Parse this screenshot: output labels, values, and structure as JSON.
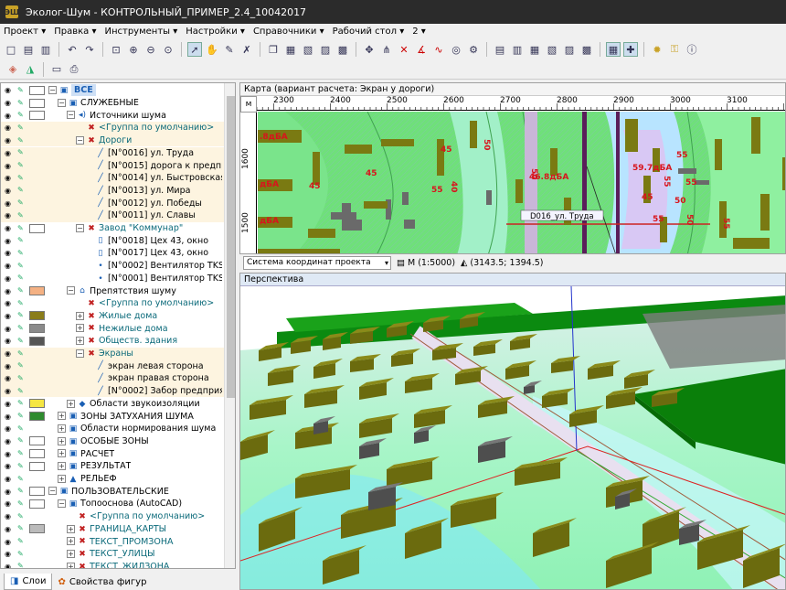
{
  "window": {
    "title": "Эколог-Шум - КОНТРОЛЬНЫЙ_ПРИМЕР_2.4_10042017",
    "logo": "ЭШ"
  },
  "menu": [
    {
      "label": "Проект"
    },
    {
      "label": "Правка"
    },
    {
      "label": "Инструменты"
    },
    {
      "label": "Настройки"
    },
    {
      "label": "Справочники"
    },
    {
      "label": "Рабочий стол"
    },
    {
      "label": "2"
    }
  ],
  "layers": [
    {
      "label": "ВСЕ",
      "indent": 0,
      "swatch": "#ffffff",
      "expand": "−",
      "icon": "folder-icon",
      "glyph": "▣",
      "color": "#1a5fb4",
      "bold": true,
      "style": "sel"
    },
    {
      "label": "СЛУЖЕБНЫЕ",
      "indent": 1,
      "swatch": "#ffffff",
      "expand": "−",
      "icon": "folder-icon",
      "glyph": "▣",
      "color": "#000"
    },
    {
      "label": "Источники шума",
      "indent": 2,
      "swatch": "#ffffff",
      "expand": "−",
      "icon": "noise-source-icon",
      "glyph": "◂)",
      "color": "#000"
    },
    {
      "label": "<Группа по умолчанию>",
      "indent": 3,
      "swatch": "",
      "expand": "",
      "icon": "group-icon",
      "glyph": "✖",
      "color": "#0b6a7a",
      "style": "hl"
    },
    {
      "label": "Дороги",
      "indent": 3,
      "swatch": "",
      "expand": "−",
      "icon": "road-group-icon",
      "glyph": "✖",
      "color": "#0b6a7a",
      "style": "hl"
    },
    {
      "label": "[N°0016] ул. Труда",
      "indent": 4,
      "swatch": "",
      "expand": "",
      "icon": "road-icon",
      "glyph": "╱",
      "color": "#000",
      "style": "hl"
    },
    {
      "label": "[N°0015] дорога к предпр...",
      "indent": 4,
      "swatch": "",
      "expand": "",
      "icon": "road-icon",
      "glyph": "╱",
      "color": "#000",
      "style": "hl"
    },
    {
      "label": "[N°0014] ул. Быстровская",
      "indent": 4,
      "swatch": "",
      "expand": "",
      "icon": "road-icon",
      "glyph": "╱",
      "color": "#000",
      "style": "hl"
    },
    {
      "label": "[N°0013] ул. Мира",
      "indent": 4,
      "swatch": "",
      "expand": "",
      "icon": "road-icon",
      "glyph": "╱",
      "color": "#000",
      "style": "hl"
    },
    {
      "label": "[N°0012] ул. Победы",
      "indent": 4,
      "swatch": "",
      "expand": "",
      "icon": "road-icon",
      "glyph": "╱",
      "color": "#000",
      "style": "hl"
    },
    {
      "label": "[N°0011] ул. Славы",
      "indent": 4,
      "swatch": "",
      "expand": "",
      "icon": "road-icon",
      "glyph": "╱",
      "color": "#000",
      "style": "hl"
    },
    {
      "label": "Завод \"Коммунар\"",
      "indent": 3,
      "swatch": "#ffffff",
      "expand": "−",
      "icon": "factory-group-icon",
      "glyph": "✖",
      "color": "#0b6a7a"
    },
    {
      "label": "[N°0018] Цех 43, окно",
      "indent": 4,
      "swatch": "",
      "expand": "",
      "icon": "window-source-icon",
      "glyph": "▯",
      "color": "#000"
    },
    {
      "label": "[N°0017] Цех 43, окно",
      "indent": 4,
      "swatch": "",
      "expand": "",
      "icon": "window-source-icon",
      "glyph": "▯",
      "color": "#000"
    },
    {
      "label": "[N°0002] Вентилятор TKS 4...",
      "indent": 4,
      "swatch": "",
      "expand": "",
      "icon": "point-source-icon",
      "glyph": "•",
      "color": "#000"
    },
    {
      "label": "[N°0001] Вентилятор TKS 4...",
      "indent": 4,
      "swatch": "",
      "expand": "",
      "icon": "point-source-icon",
      "glyph": "•",
      "color": "#000"
    },
    {
      "label": "Препятствия шуму",
      "indent": 2,
      "swatch": "#f4b183",
      "expand": "−",
      "icon": "obstacle-icon",
      "glyph": "⌂",
      "color": "#000"
    },
    {
      "label": "<Группа по умолчанию>",
      "indent": 3,
      "swatch": "",
      "expand": "",
      "icon": "group-icon",
      "glyph": "✖",
      "color": "#0b6a7a"
    },
    {
      "label": "Жилые дома",
      "indent": 3,
      "swatch": "#8a7d1a",
      "expand": "+",
      "icon": "group-icon",
      "glyph": "✖",
      "color": "#0b6a7a"
    },
    {
      "label": "Нежилые дома",
      "indent": 3,
      "swatch": "#8a8a8a",
      "expand": "+",
      "icon": "group-icon",
      "glyph": "✖",
      "color": "#0b6a7a"
    },
    {
      "label": "Обществ. здания",
      "indent": 3,
      "swatch": "#555555",
      "expand": "+",
      "icon": "group-icon",
      "glyph": "✖",
      "color": "#0b6a7a"
    },
    {
      "label": "Экраны",
      "indent": 3,
      "swatch": "",
      "expand": "−",
      "icon": "group-icon",
      "glyph": "✖",
      "color": "#0b6a7a",
      "style": "hl"
    },
    {
      "label": "экран левая сторона",
      "indent": 4,
      "swatch": "",
      "expand": "",
      "icon": "screen-icon",
      "glyph": "╱",
      "color": "#000",
      "style": "hl"
    },
    {
      "label": "экран правая сторона",
      "indent": 4,
      "swatch": "",
      "expand": "",
      "icon": "screen-icon",
      "glyph": "╱",
      "color": "#000",
      "style": "hl"
    },
    {
      "label": "[N°0002] Забор предприятия",
      "indent": 4,
      "swatch": "",
      "expand": "",
      "icon": "screen-icon",
      "glyph": "╱",
      "color": "#000",
      "style": "hl"
    },
    {
      "label": "Области звукоизоляции",
      "indent": 2,
      "swatch": "#f5e642",
      "expand": "+",
      "icon": "area-icon",
      "glyph": "◆",
      "color": "#000"
    },
    {
      "label": "ЗОНЫ ЗАТУХАНИЯ ШУМА",
      "indent": 1,
      "swatch": "#2e8b2e",
      "expand": "+",
      "icon": "folder-icon",
      "glyph": "▣",
      "color": "#000"
    },
    {
      "label": "Области нормирования шума",
      "indent": 1,
      "swatch": "",
      "expand": "+",
      "icon": "folder-icon",
      "glyph": "▣",
      "color": "#000"
    },
    {
      "label": "ОСОБЫЕ ЗОНЫ",
      "indent": 1,
      "swatch": "#ffffff",
      "expand": "+",
      "icon": "folder-icon",
      "glyph": "▣",
      "color": "#000"
    },
    {
      "label": "РАСЧЕТ",
      "indent": 1,
      "swatch": "#ffffff",
      "expand": "+",
      "icon": "folder-icon",
      "glyph": "▣",
      "color": "#000"
    },
    {
      "label": "РЕЗУЛЬТАТ",
      "indent": 1,
      "swatch": "#ffffff",
      "expand": "+",
      "icon": "folder-icon",
      "glyph": "▣",
      "color": "#000"
    },
    {
      "label": "РЕЛЬЕФ",
      "indent": 1,
      "swatch": "",
      "expand": "+",
      "icon": "relief-icon",
      "glyph": "▲",
      "color": "#000"
    },
    {
      "label": "ПОЛЬЗОВАТЕЛЬСКИЕ",
      "indent": 0,
      "swatch": "#ffffff",
      "expand": "−",
      "icon": "folder-icon",
      "glyph": "▣",
      "color": "#000"
    },
    {
      "label": "Топооснова (AutoCAD)",
      "indent": 1,
      "swatch": "#ffffff",
      "expand": "−",
      "icon": "folder-icon",
      "glyph": "▣",
      "color": "#000"
    },
    {
      "label": "<Группа по умолчанию>",
      "indent": 2,
      "swatch": "",
      "expand": "",
      "icon": "group-icon",
      "glyph": "✖",
      "color": "#0b6a7a"
    },
    {
      "label": "ГРАНИЦА_КАРТЫ",
      "indent": 2,
      "swatch": "#bbbbbb",
      "expand": "+",
      "icon": "group-icon",
      "glyph": "✖",
      "color": "#0b6a7a"
    },
    {
      "label": "ТЕКСТ_ПРОМЗОНА",
      "indent": 2,
      "swatch": "",
      "expand": "+",
      "icon": "group-icon",
      "glyph": "✖",
      "color": "#0b6a7a"
    },
    {
      "label": "ТЕКСТ_УЛИЦЫ",
      "indent": 2,
      "swatch": "",
      "expand": "+",
      "icon": "group-icon",
      "glyph": "✖",
      "color": "#0b6a7a"
    },
    {
      "label": "ТЕКСТ_ЖИЛЗОНА",
      "indent": 2,
      "swatch": "",
      "expand": "+",
      "icon": "group-icon",
      "glyph": "✖",
      "color": "#0b6a7a"
    }
  ],
  "bottom_tabs": [
    {
      "label": "Слои",
      "active": true,
      "icon": "layers-icon",
      "glyph": "◨"
    },
    {
      "label": "Свойства фигур",
      "active": false,
      "icon": "properties-icon",
      "glyph": "✿"
    }
  ],
  "map": {
    "header": "Карта (вариант расчета: Экран у дороги)",
    "tab_m": "м",
    "x_ticks": [
      "2300",
      "2400",
      "2500",
      "2600",
      "2700",
      "2800",
      "2900",
      "3000",
      "3100"
    ],
    "y_ticks": [
      "1600",
      "1500"
    ],
    "labels": [
      {
        "text": "46.8дБА"
      },
      {
        "text": "59.7дБА"
      },
      {
        "text": "D016_ул. Труда"
      },
      {
        "text": ".8дБА"
      },
      {
        "text": "дБА"
      },
      {
        "text": "дБА"
      },
      {
        "text": "45"
      },
      {
        "text": "50"
      },
      {
        "text": "55"
      },
      {
        "text": "40"
      },
      {
        "text": "45"
      },
      {
        "text": "45"
      },
      {
        "text": "50"
      },
      {
        "text": "55"
      },
      {
        "text": "55"
      },
      {
        "text": "50"
      },
      {
        "text": "45"
      },
      {
        "text": "55"
      },
      {
        "text": "55"
      },
      {
        "text": "50"
      },
      {
        "text": "55"
      }
    ]
  },
  "map_status": {
    "coord_system": "Система координат проекта",
    "scale": "М (1:5000)",
    "coords": "(3143.5; 1394.5)"
  },
  "perspective": {
    "header": "Перспектива"
  }
}
